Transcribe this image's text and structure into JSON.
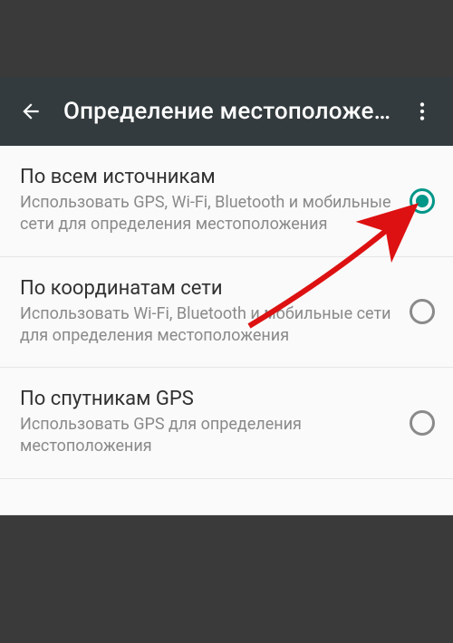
{
  "appbar": {
    "title": "Определение местоположен…"
  },
  "options": [
    {
      "title": "По всем источникам",
      "desc": "Использовать GPS, Wi-Fi, Bluetooth и мобильные сети для определения местоположения",
      "selected": true
    },
    {
      "title": "По координатам сети",
      "desc": "Использовать Wi-Fi, Bluetooth и мобильные сети для определения местоположения",
      "selected": false
    },
    {
      "title": "По спутникам GPS",
      "desc": "Использовать GPS для определения местоположения",
      "selected": false
    }
  ]
}
